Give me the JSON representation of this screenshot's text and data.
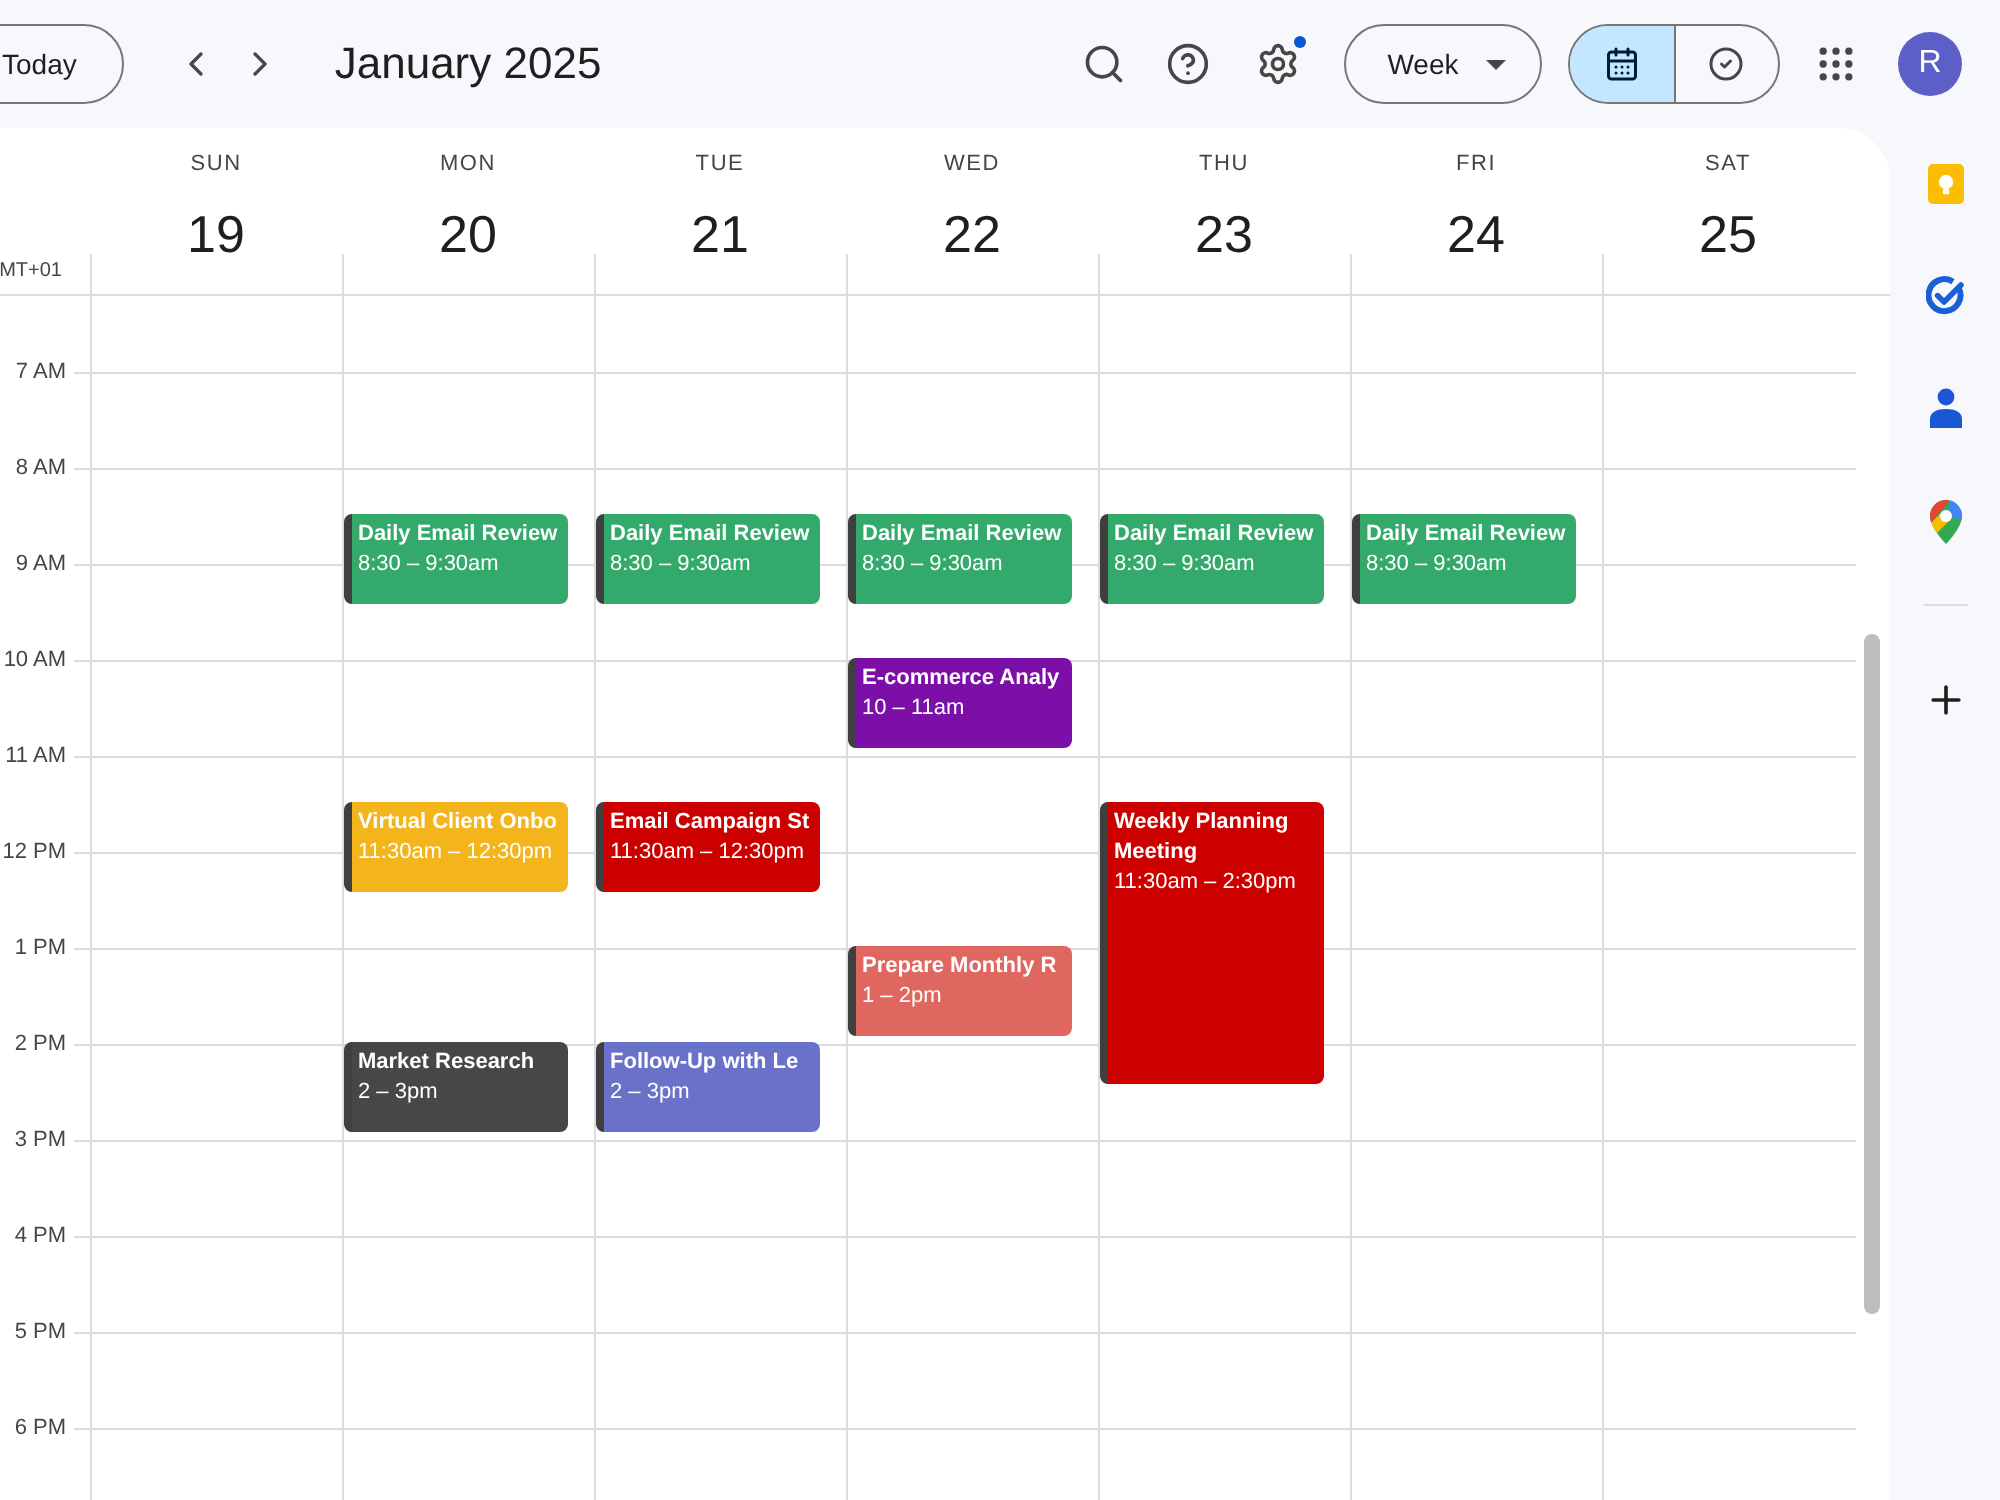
{
  "toolbar": {
    "today_button": "Today",
    "title": "January 2025",
    "settings_badge": true,
    "view_select": "Week",
    "view_toggle": [
      {
        "selected": true
      },
      {
        "selected": false
      }
    ],
    "avatar": "R"
  },
  "calendar": {
    "timezone": "MT+01",
    "days": [
      {
        "name": "SUN",
        "date": "19"
      },
      {
        "name": "MON",
        "date": "20",
        "events": [
          {
            "title": "Daily Email Review",
            "time": "8:30 – 9:30am",
            "color": "#33a96b"
          },
          {
            "title": "Virtual Client Onbo",
            "time": "11:30am – 12:30pm",
            "color": "#f4b41c"
          },
          {
            "title": "Market Research",
            "time": "2 – 3pm",
            "color": "#474747"
          }
        ]
      },
      {
        "name": "TUE",
        "date": "21",
        "events": [
          {
            "title": "Daily Email Review",
            "time": "8:30 – 9:30am",
            "color": "#33a96b"
          },
          {
            "title": "Email Campaign St",
            "time": "11:30am – 12:30pm",
            "color": "#cd0000"
          },
          {
            "title": "Follow-Up with Le",
            "time": "2 – 3pm",
            "color": "#6a71c8"
          }
        ]
      },
      {
        "name": "WED",
        "date": "22",
        "events": [
          {
            "title": "Daily Email Review",
            "time": "8:30 – 9:30am",
            "color": "#33a96b"
          },
          {
            "title": "E-commerce Analy",
            "time": "10 – 11am",
            "color": "#7c0fa8"
          },
          {
            "title": "Prepare Monthly R",
            "time": "1 – 2pm",
            "color": "#e0675f"
          }
        ]
      },
      {
        "name": "THU",
        "date": "23",
        "events": [
          {
            "title": "Daily Email Review",
            "time": "8:30 – 9:30am",
            "color": "#33a96b"
          },
          {
            "title": "Weekly Planning Meeting",
            "time": "11:30am – 2:30pm",
            "color": "#cd0000"
          }
        ]
      },
      {
        "name": "FRI",
        "date": "24",
        "events": [
          {
            "title": "Daily Email Review",
            "time": "8:30 – 9:30am",
            "color": "#33a96b"
          }
        ]
      },
      {
        "name": "SAT",
        "date": "25"
      }
    ],
    "time_labels": [
      "7 AM",
      "8 AM",
      "9 AM",
      "10 AM",
      "11 AM",
      "12 PM",
      "1 PM",
      "2 PM",
      "3 PM",
      "4 PM",
      "5 PM",
      "6 PM"
    ]
  }
}
